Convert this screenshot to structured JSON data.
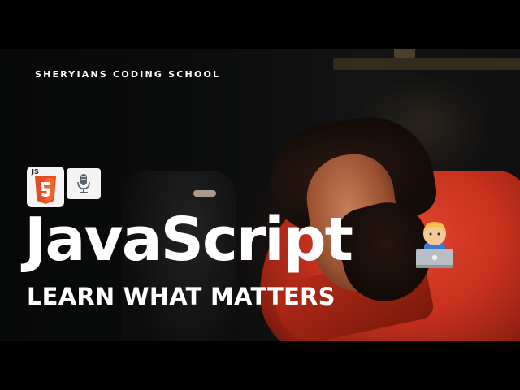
{
  "brand": {
    "name": "SHERYIANS CODING SCHOOL"
  },
  "badges": [
    {
      "label": "JS",
      "icon": "html5-shield-icon",
      "color": "#e44d26"
    },
    {
      "icon": "microphone-icon"
    }
  ],
  "headline": {
    "title": "JavaScript",
    "emoji": "technologist-emoji-icon"
  },
  "tagline": {
    "text": "LEARN WHAT MATTERS"
  },
  "colors": {
    "hoodie": "#c8321e",
    "text": "#ffffff",
    "shield": "#e44d26",
    "background": "#000000"
  }
}
